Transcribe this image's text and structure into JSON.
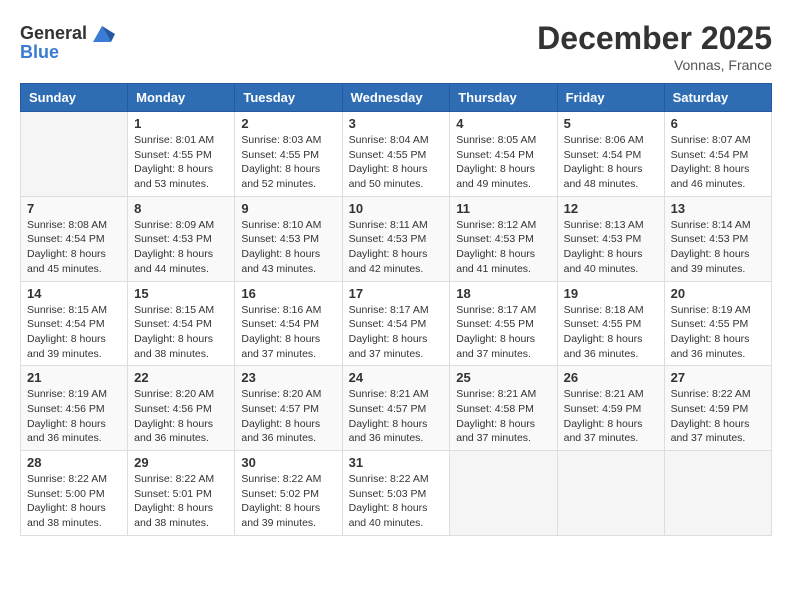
{
  "logo": {
    "general": "General",
    "blue": "Blue"
  },
  "title": "December 2025",
  "location": "Vonnas, France",
  "weekdays": [
    "Sunday",
    "Monday",
    "Tuesday",
    "Wednesday",
    "Thursday",
    "Friday",
    "Saturday"
  ],
  "weeks": [
    [
      {
        "day": "",
        "info": ""
      },
      {
        "day": "1",
        "info": "Sunrise: 8:01 AM\nSunset: 4:55 PM\nDaylight: 8 hours\nand 53 minutes."
      },
      {
        "day": "2",
        "info": "Sunrise: 8:03 AM\nSunset: 4:55 PM\nDaylight: 8 hours\nand 52 minutes."
      },
      {
        "day": "3",
        "info": "Sunrise: 8:04 AM\nSunset: 4:55 PM\nDaylight: 8 hours\nand 50 minutes."
      },
      {
        "day": "4",
        "info": "Sunrise: 8:05 AM\nSunset: 4:54 PM\nDaylight: 8 hours\nand 49 minutes."
      },
      {
        "day": "5",
        "info": "Sunrise: 8:06 AM\nSunset: 4:54 PM\nDaylight: 8 hours\nand 48 minutes."
      },
      {
        "day": "6",
        "info": "Sunrise: 8:07 AM\nSunset: 4:54 PM\nDaylight: 8 hours\nand 46 minutes."
      }
    ],
    [
      {
        "day": "7",
        "info": "Sunrise: 8:08 AM\nSunset: 4:54 PM\nDaylight: 8 hours\nand 45 minutes."
      },
      {
        "day": "8",
        "info": "Sunrise: 8:09 AM\nSunset: 4:53 PM\nDaylight: 8 hours\nand 44 minutes."
      },
      {
        "day": "9",
        "info": "Sunrise: 8:10 AM\nSunset: 4:53 PM\nDaylight: 8 hours\nand 43 minutes."
      },
      {
        "day": "10",
        "info": "Sunrise: 8:11 AM\nSunset: 4:53 PM\nDaylight: 8 hours\nand 42 minutes."
      },
      {
        "day": "11",
        "info": "Sunrise: 8:12 AM\nSunset: 4:53 PM\nDaylight: 8 hours\nand 41 minutes."
      },
      {
        "day": "12",
        "info": "Sunrise: 8:13 AM\nSunset: 4:53 PM\nDaylight: 8 hours\nand 40 minutes."
      },
      {
        "day": "13",
        "info": "Sunrise: 8:14 AM\nSunset: 4:53 PM\nDaylight: 8 hours\nand 39 minutes."
      }
    ],
    [
      {
        "day": "14",
        "info": "Sunrise: 8:15 AM\nSunset: 4:54 PM\nDaylight: 8 hours\nand 39 minutes."
      },
      {
        "day": "15",
        "info": "Sunrise: 8:15 AM\nSunset: 4:54 PM\nDaylight: 8 hours\nand 38 minutes."
      },
      {
        "day": "16",
        "info": "Sunrise: 8:16 AM\nSunset: 4:54 PM\nDaylight: 8 hours\nand 37 minutes."
      },
      {
        "day": "17",
        "info": "Sunrise: 8:17 AM\nSunset: 4:54 PM\nDaylight: 8 hours\nand 37 minutes."
      },
      {
        "day": "18",
        "info": "Sunrise: 8:17 AM\nSunset: 4:55 PM\nDaylight: 8 hours\nand 37 minutes."
      },
      {
        "day": "19",
        "info": "Sunrise: 8:18 AM\nSunset: 4:55 PM\nDaylight: 8 hours\nand 36 minutes."
      },
      {
        "day": "20",
        "info": "Sunrise: 8:19 AM\nSunset: 4:55 PM\nDaylight: 8 hours\nand 36 minutes."
      }
    ],
    [
      {
        "day": "21",
        "info": "Sunrise: 8:19 AM\nSunset: 4:56 PM\nDaylight: 8 hours\nand 36 minutes."
      },
      {
        "day": "22",
        "info": "Sunrise: 8:20 AM\nSunset: 4:56 PM\nDaylight: 8 hours\nand 36 minutes."
      },
      {
        "day": "23",
        "info": "Sunrise: 8:20 AM\nSunset: 4:57 PM\nDaylight: 8 hours\nand 36 minutes."
      },
      {
        "day": "24",
        "info": "Sunrise: 8:21 AM\nSunset: 4:57 PM\nDaylight: 8 hours\nand 36 minutes."
      },
      {
        "day": "25",
        "info": "Sunrise: 8:21 AM\nSunset: 4:58 PM\nDaylight: 8 hours\nand 37 minutes."
      },
      {
        "day": "26",
        "info": "Sunrise: 8:21 AM\nSunset: 4:59 PM\nDaylight: 8 hours\nand 37 minutes."
      },
      {
        "day": "27",
        "info": "Sunrise: 8:22 AM\nSunset: 4:59 PM\nDaylight: 8 hours\nand 37 minutes."
      }
    ],
    [
      {
        "day": "28",
        "info": "Sunrise: 8:22 AM\nSunset: 5:00 PM\nDaylight: 8 hours\nand 38 minutes."
      },
      {
        "day": "29",
        "info": "Sunrise: 8:22 AM\nSunset: 5:01 PM\nDaylight: 8 hours\nand 38 minutes."
      },
      {
        "day": "30",
        "info": "Sunrise: 8:22 AM\nSunset: 5:02 PM\nDaylight: 8 hours\nand 39 minutes."
      },
      {
        "day": "31",
        "info": "Sunrise: 8:22 AM\nSunset: 5:03 PM\nDaylight: 8 hours\nand 40 minutes."
      },
      {
        "day": "",
        "info": ""
      },
      {
        "day": "",
        "info": ""
      },
      {
        "day": "",
        "info": ""
      }
    ]
  ]
}
